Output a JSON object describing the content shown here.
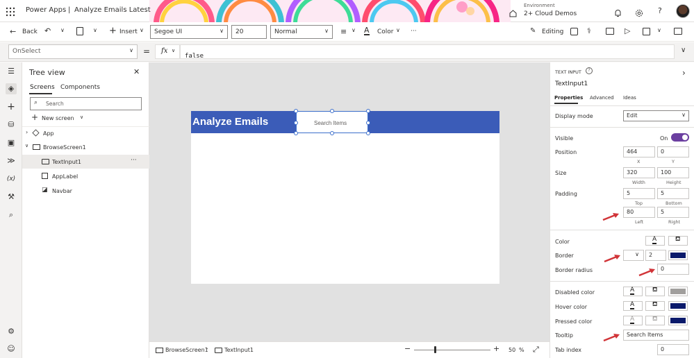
{
  "topbar": {
    "app_name": "Power Apps",
    "separator": "|",
    "doc_title": "Analyze Emails Latest",
    "env_label": "Environment",
    "env_name": "2+ Cloud Demos",
    "icons": [
      "app-launcher-icon",
      "environment-icon",
      "bell-icon",
      "gear-icon",
      "help-icon",
      "avatar"
    ]
  },
  "toolbar": {
    "back": "Back",
    "insert": "Insert",
    "font": "Segoe UI",
    "font_size": "20",
    "font_weight": "Normal",
    "color": "Color",
    "more": "···",
    "editing": "Editing"
  },
  "formula": {
    "property": "OnSelect",
    "equals": "=",
    "fx": "fx",
    "value": "false"
  },
  "tree": {
    "title": "Tree view",
    "tabs": [
      "Screens",
      "Components"
    ],
    "search_placeholder": "Search",
    "new_screen": "New screen",
    "items": [
      {
        "label": "App"
      },
      {
        "label": "BrowseScreen1"
      },
      {
        "label": "TextInput1"
      },
      {
        "label": "AppLabel"
      },
      {
        "label": "Navbar"
      }
    ],
    "more": "···"
  },
  "canvas": {
    "header_title": "Analyze Emails",
    "search_placeholder": "Search Items",
    "header_color": "#3b5cb8"
  },
  "status": {
    "screen": "BrowseScreen1",
    "control": "TextInput1",
    "zoom_minus": "−",
    "zoom_plus": "+",
    "zoom": "50",
    "zoom_unit": "%"
  },
  "props": {
    "type_label": "TEXT INPUT",
    "control_name": "TextInput1",
    "tabs": [
      "Properties",
      "Advanced",
      "Ideas"
    ],
    "display_mode_label": "Display mode",
    "display_mode_value": "Edit",
    "visible_label": "Visible",
    "visible_value": "On",
    "position_label": "Position",
    "pos_x": "464",
    "pos_y": "0",
    "x_label": "X",
    "y_label": "Y",
    "size_label": "Size",
    "width": "320",
    "height": "100",
    "width_label": "Width",
    "height_label": "Height",
    "padding_label": "Padding",
    "pad_top": "5",
    "pad_bottom": "5",
    "pad_left": "80",
    "pad_right": "5",
    "top_label": "Top",
    "bottom_label": "Bottom",
    "left_label": "Left",
    "right_label": "Right",
    "color_label": "Color",
    "border_label": "Border",
    "border_width": "2",
    "border_radius_label": "Border radius",
    "border_radius_value": "0",
    "disabled_color_label": "Disabled color",
    "hover_color_label": "Hover color",
    "pressed_color_label": "Pressed color",
    "tooltip_label": "Tooltip",
    "tooltip_value": "Search Items",
    "tab_index_label": "Tab index",
    "tab_index_value": "0",
    "icon_letter": "A",
    "border_color": "#0b1a6b",
    "toggle_color": "#6b3fa0"
  }
}
